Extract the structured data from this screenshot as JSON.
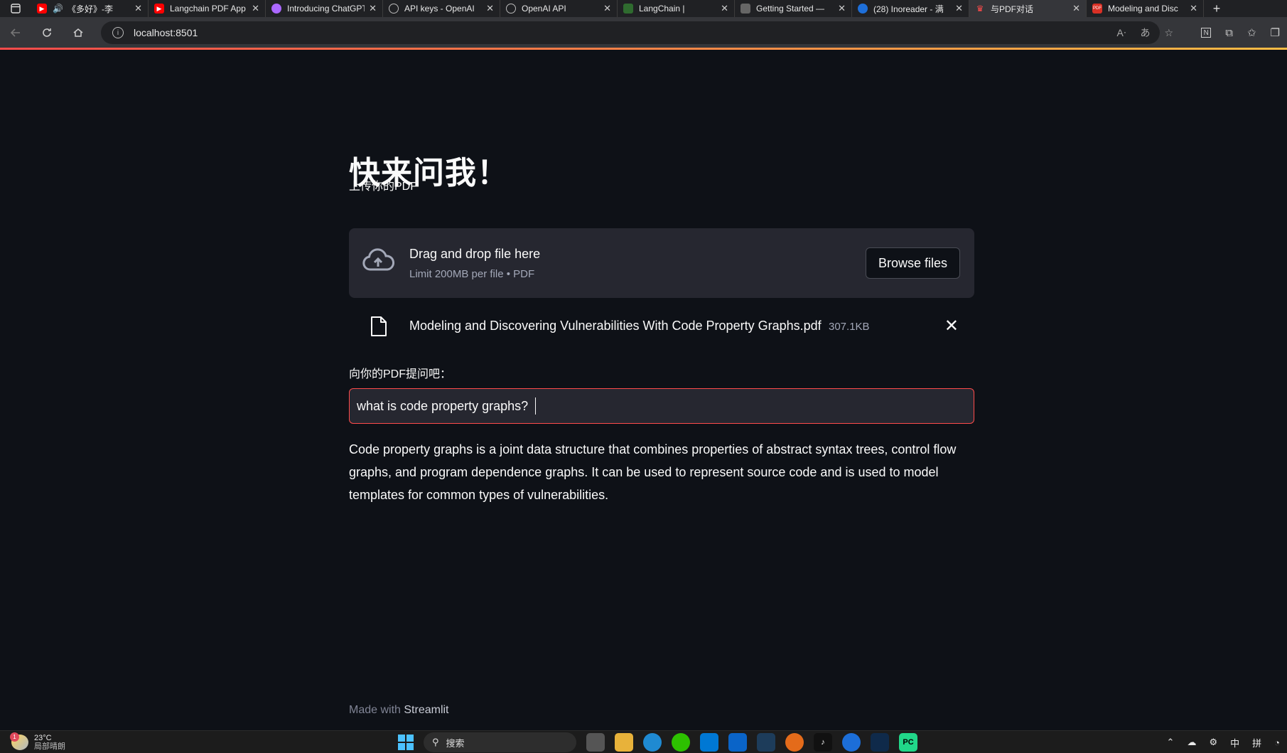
{
  "browser": {
    "tabs": [
      {
        "title": "《多好》-李",
        "favicon": "youtube-icon",
        "color": "#ff0000",
        "audio": true
      },
      {
        "title": "Langchain PDF App",
        "favicon": "youtube-icon",
        "color": "#ff0000"
      },
      {
        "title": "Introducing ChatGPT",
        "favicon": "openai-icon",
        "color": "#ab68ff"
      },
      {
        "title": "API keys - OpenAI",
        "favicon": "openai-icon",
        "color": "#555"
      },
      {
        "title": "OpenAI API",
        "favicon": "openai-icon",
        "color": "#555"
      },
      {
        "title": "LangChain |",
        "favicon": "langchain-icon",
        "color": "#2f6b2f"
      },
      {
        "title": "Getting Started —",
        "favicon": "docs-icon",
        "color": "#666"
      },
      {
        "title": "(28) Inoreader - 满",
        "favicon": "inoreader-icon",
        "color": "#1e6fd9"
      },
      {
        "title": "与PDF对话",
        "favicon": "streamlit-icon",
        "color": "#ff4b4b",
        "active": true
      },
      {
        "title": "Modeling and Disc",
        "favicon": "pdf-icon",
        "color": "#d93025"
      }
    ],
    "address": "localhost:8501",
    "new_tab": "+"
  },
  "app": {
    "title": "快来问我！",
    "upload_label": "上传你的PDF",
    "dropzone_title": "Drag and drop file here",
    "dropzone_limit": "Limit 200MB per file • PDF",
    "browse_label": "Browse files",
    "file_name": "Modeling and Discovering Vulnerabilities With Code Property Graphs.pdf",
    "file_size": "307.1KB",
    "close_symbol": "✕",
    "question_label": "向你的PDF提问吧：",
    "question_value": "what is code property graphs?",
    "answer": "Code property graphs is a joint data structure that combines properties of abstract syntax trees, control flow graphs, and program dependence graphs. It can be used to represent source code and is used to model templates for common types of vulnerabilities."
  },
  "footer": {
    "prefix": "Made with",
    "brand": "Streamlit"
  },
  "taskbar": {
    "weather_temp": "23°C",
    "weather_desc": "局部晴朗",
    "weather_badge": "1",
    "search_placeholder": "搜索",
    "tray_ime": "中",
    "tray_layout": "拼"
  },
  "colors": {
    "accent": "#ff4b4b",
    "background": "#0e1117",
    "panel": "#262730"
  }
}
